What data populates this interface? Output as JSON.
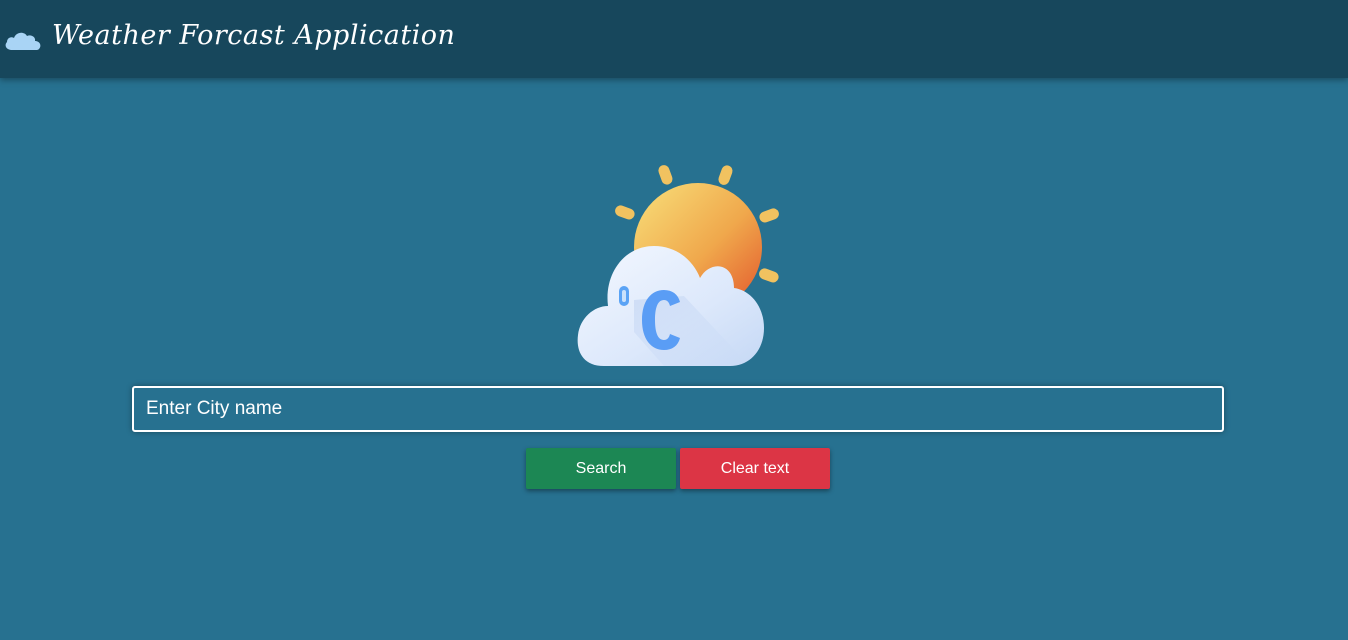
{
  "header": {
    "title": "Weather Forcast Application",
    "icon": "cloud-icon",
    "background": "#17475c"
  },
  "main": {
    "logo_icon": "sun-cloud-celsius-icon",
    "background": "#277190",
    "search": {
      "placeholder": "Enter City name",
      "value": ""
    },
    "buttons": {
      "search_label": "Search",
      "search_color": "#1c8754",
      "clear_label": "Clear text",
      "clear_color": "#dc3545"
    }
  }
}
